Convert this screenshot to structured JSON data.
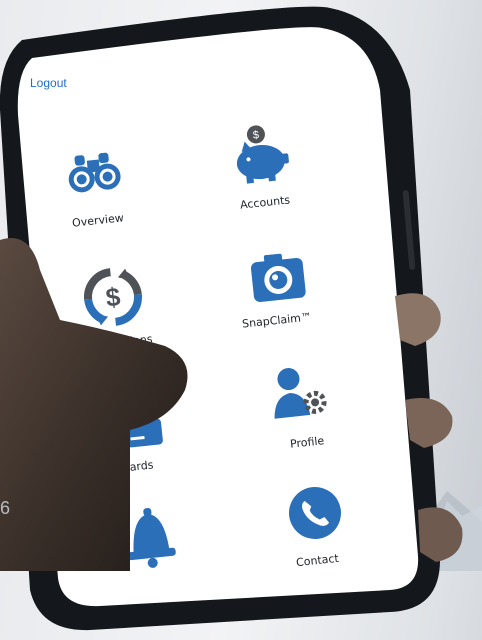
{
  "app": {
    "logout_label": "Logout",
    "accent_color": "#2b6fb8",
    "icon_gray": "#4f5358"
  },
  "menu": [
    {
      "label": "Overview",
      "icon": "binoculars-icon"
    },
    {
      "label": "Accounts",
      "icon": "piggy-bank-icon"
    },
    {
      "label": "Transactions",
      "icon": "dollar-cycle-icon"
    },
    {
      "label": "SnapClaim™",
      "icon": "camera-icon"
    },
    {
      "label": "Cards",
      "icon": "card-icon"
    },
    {
      "label": "Profile",
      "icon": "user-gear-icon"
    },
    {
      "label": "",
      "icon": "bell-icon"
    },
    {
      "label": "Contact",
      "icon": "phone-icon"
    }
  ],
  "page_number": "6"
}
